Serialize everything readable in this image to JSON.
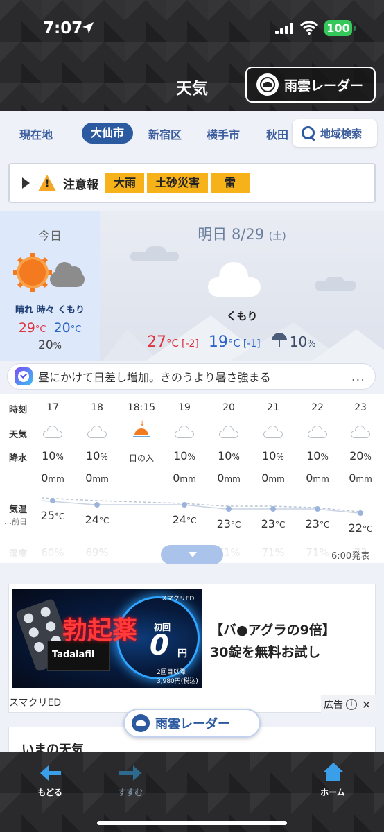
{
  "status": {
    "time": "7:07",
    "battery": "100"
  },
  "header": {
    "title": "天気",
    "radar_button": "雨雲レーダー"
  },
  "tabs": {
    "items": [
      "現在地",
      "大仙市",
      "新宿区",
      "横手市",
      "秋田"
    ],
    "active": "大仙市",
    "search_label": "地域検索"
  },
  "alert": {
    "label": "注意報",
    "tags": [
      "大雨",
      "土砂災害",
      "雷"
    ]
  },
  "today": {
    "label": "今日",
    "desc": "晴れ 時々 くもり",
    "high": "29",
    "low": "20",
    "unit": "°C",
    "rain": "20",
    "rain_unit": "%"
  },
  "tomorrow": {
    "title": "明日 8/29",
    "dow": "(土)",
    "desc": "くもり",
    "high": "27",
    "high_diff": "[-2]",
    "low": "19",
    "low_diff": "[-1]",
    "unit": "°C",
    "rain": "10",
    "rain_unit": "%"
  },
  "comment": {
    "text": "昼にかけて日差し増加。きのうより暑さ強まる",
    "more": "..."
  },
  "hourly": {
    "row_labels": {
      "time": "時刻",
      "weather": "天気",
      "rain": "降水",
      "temp": "気温",
      "prev": "…前日",
      "humid": "湿度"
    },
    "hours": [
      {
        "time": "17",
        "rain": "10",
        "amt": "0",
        "temp": "25",
        "humid": "60%"
      },
      {
        "time": "18",
        "rain": "10",
        "amt": "0",
        "temp": "24",
        "humid": "69%"
      },
      {
        "time": "18:15",
        "sunset": "日の入"
      },
      {
        "time": "19",
        "rain": "10",
        "amt": "0",
        "temp": "24",
        "humid": ""
      },
      {
        "time": "20",
        "rain": "10",
        "amt": "0",
        "temp": "23",
        "humid": "71%"
      },
      {
        "time": "21",
        "rain": "10",
        "amt": "0",
        "temp": "23",
        "humid": "71%"
      },
      {
        "time": "22",
        "rain": "10",
        "amt": "0",
        "temp": "23",
        "humid": "71%"
      },
      {
        "time": "23",
        "rain": "20",
        "amt": "0",
        "temp": "22",
        "humid": "73"
      }
    ],
    "rain_unit": "%",
    "amt_unit": "mm",
    "temp_unit": "°C",
    "issued": "6:00発表"
  },
  "ad": {
    "brand": "スマクリED",
    "headline": "勃起薬",
    "first_label": "初回",
    "price_big": "0",
    "price_yen": "円",
    "price_note": "2回目以降 3,980円(税込)",
    "product": "Tadalafil",
    "copy_line1": "【バ●アグラの9倍】",
    "copy_line2": "30錠を無料お試し",
    "source": "スマクリED",
    "badge": "広告"
  },
  "float_radar": "雨雲レーダー",
  "now_weather": {
    "title": "いまの天気"
  },
  "bottom_nav": {
    "back": "もどる",
    "forward": "すすむ",
    "home": "ホーム"
  }
}
